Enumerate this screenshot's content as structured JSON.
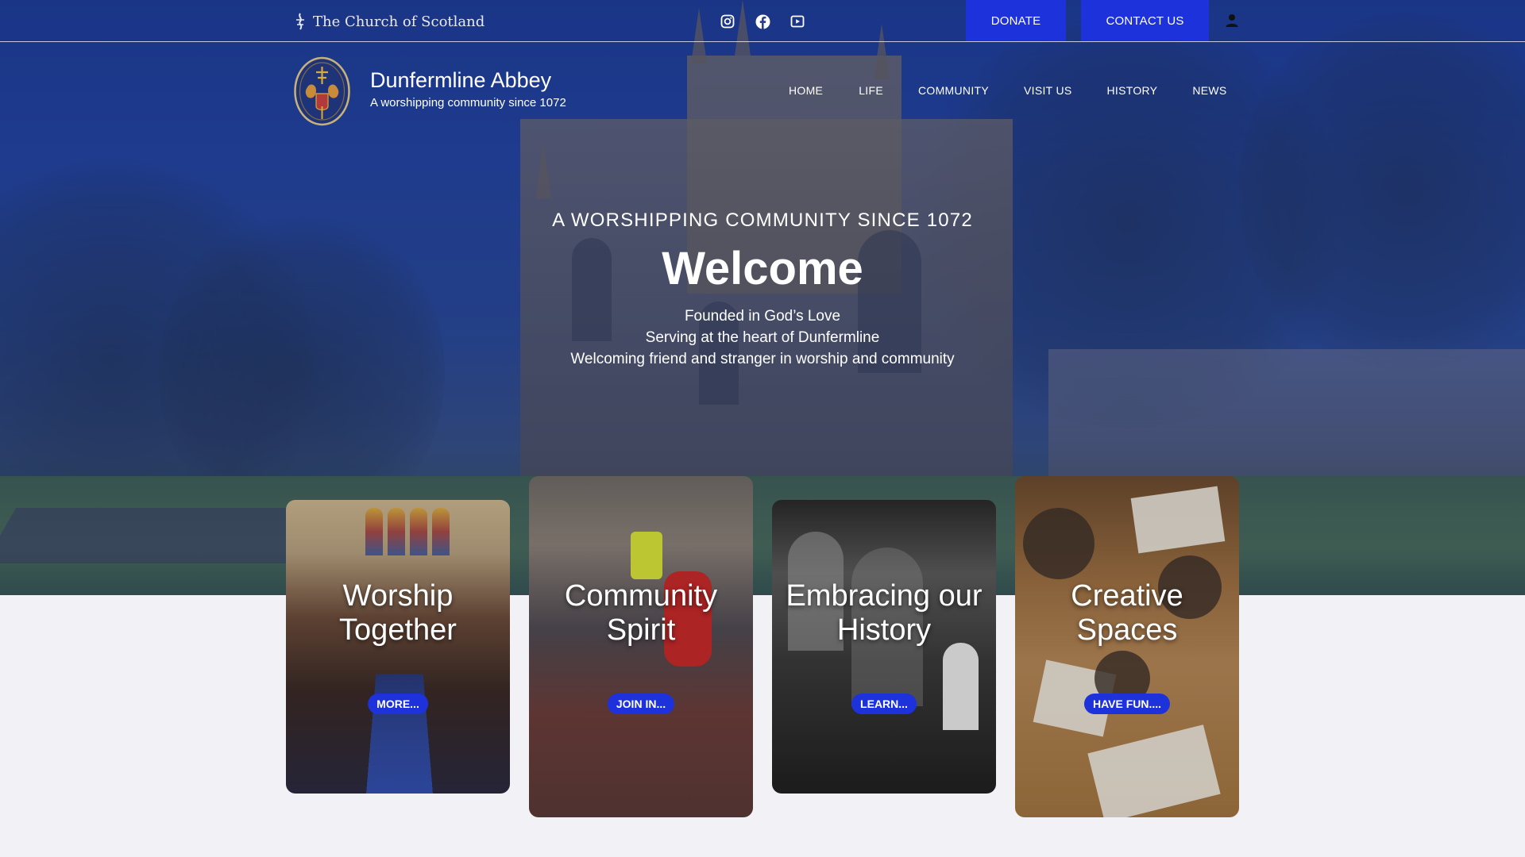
{
  "topbar": {
    "brand_label": "The Church of Scotland",
    "social_icons": [
      "instagram-icon",
      "facebook-icon",
      "youtube-icon"
    ],
    "donate_label": "DONATE",
    "contact_label": "CONTACT US",
    "user_icon": "user-icon"
  },
  "header": {
    "site_title": "Dunfermline Abbey",
    "tagline": "A worshipping community since 1072",
    "nav": [
      "HOME",
      "LIFE",
      "COMMUNITY",
      "VISIT US",
      "HISTORY",
      "NEWS"
    ]
  },
  "hero": {
    "eyebrow": "A WORSHIPPING COMMUNITY SINCE 1072",
    "title": "Welcome",
    "lines": [
      "Founded in God’s Love",
      "Serving at the heart of Dunfermline",
      "Welcoming friend and stranger in worship and community"
    ]
  },
  "cards": [
    {
      "title_line1": "Worship",
      "title_line2": "Together",
      "button": "MORE..."
    },
    {
      "title_line1": "Community",
      "title_line2": "Spirit",
      "button": "JOIN IN..."
    },
    {
      "title_line1": "Embracing our",
      "title_line2": "History",
      "button": "LEARN..."
    },
    {
      "title_line1": "Creative",
      "title_line2": "Spaces",
      "button": "HAVE FUN...."
    }
  ],
  "colors": {
    "accent": "#1e32dc",
    "hero_overlay": "#182c78",
    "page_background": "#f1f1f6"
  }
}
